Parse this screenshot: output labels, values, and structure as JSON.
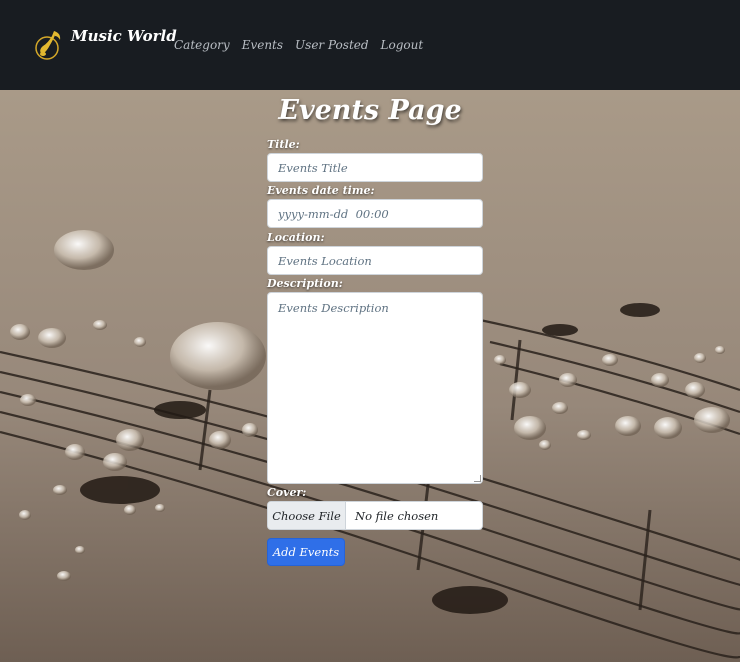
{
  "nav": {
    "brand": "Music World",
    "links": [
      "Category",
      "Events",
      "User Posted",
      "Logout"
    ]
  },
  "page": {
    "title": "Events Page"
  },
  "form": {
    "title_label": "Title:",
    "title_placeholder": "Events Title",
    "datetime_label": "Events date time:",
    "datetime_placeholder": "yyyy-mm-dd  00:00",
    "location_label": "Location:",
    "location_placeholder": "Events Location",
    "description_label": "Description:",
    "description_placeholder": "Events Description",
    "cover_label": "Cover:",
    "choose_file_label": "Choose File",
    "file_status": "No file chosen",
    "submit_label": "Add Events"
  },
  "colors": {
    "navbar": "#181c21",
    "primary_button": "#2f6fe8",
    "logo_gold": "#d4a829"
  },
  "icons": {
    "brand_logo": "music-note-logo-icon"
  }
}
